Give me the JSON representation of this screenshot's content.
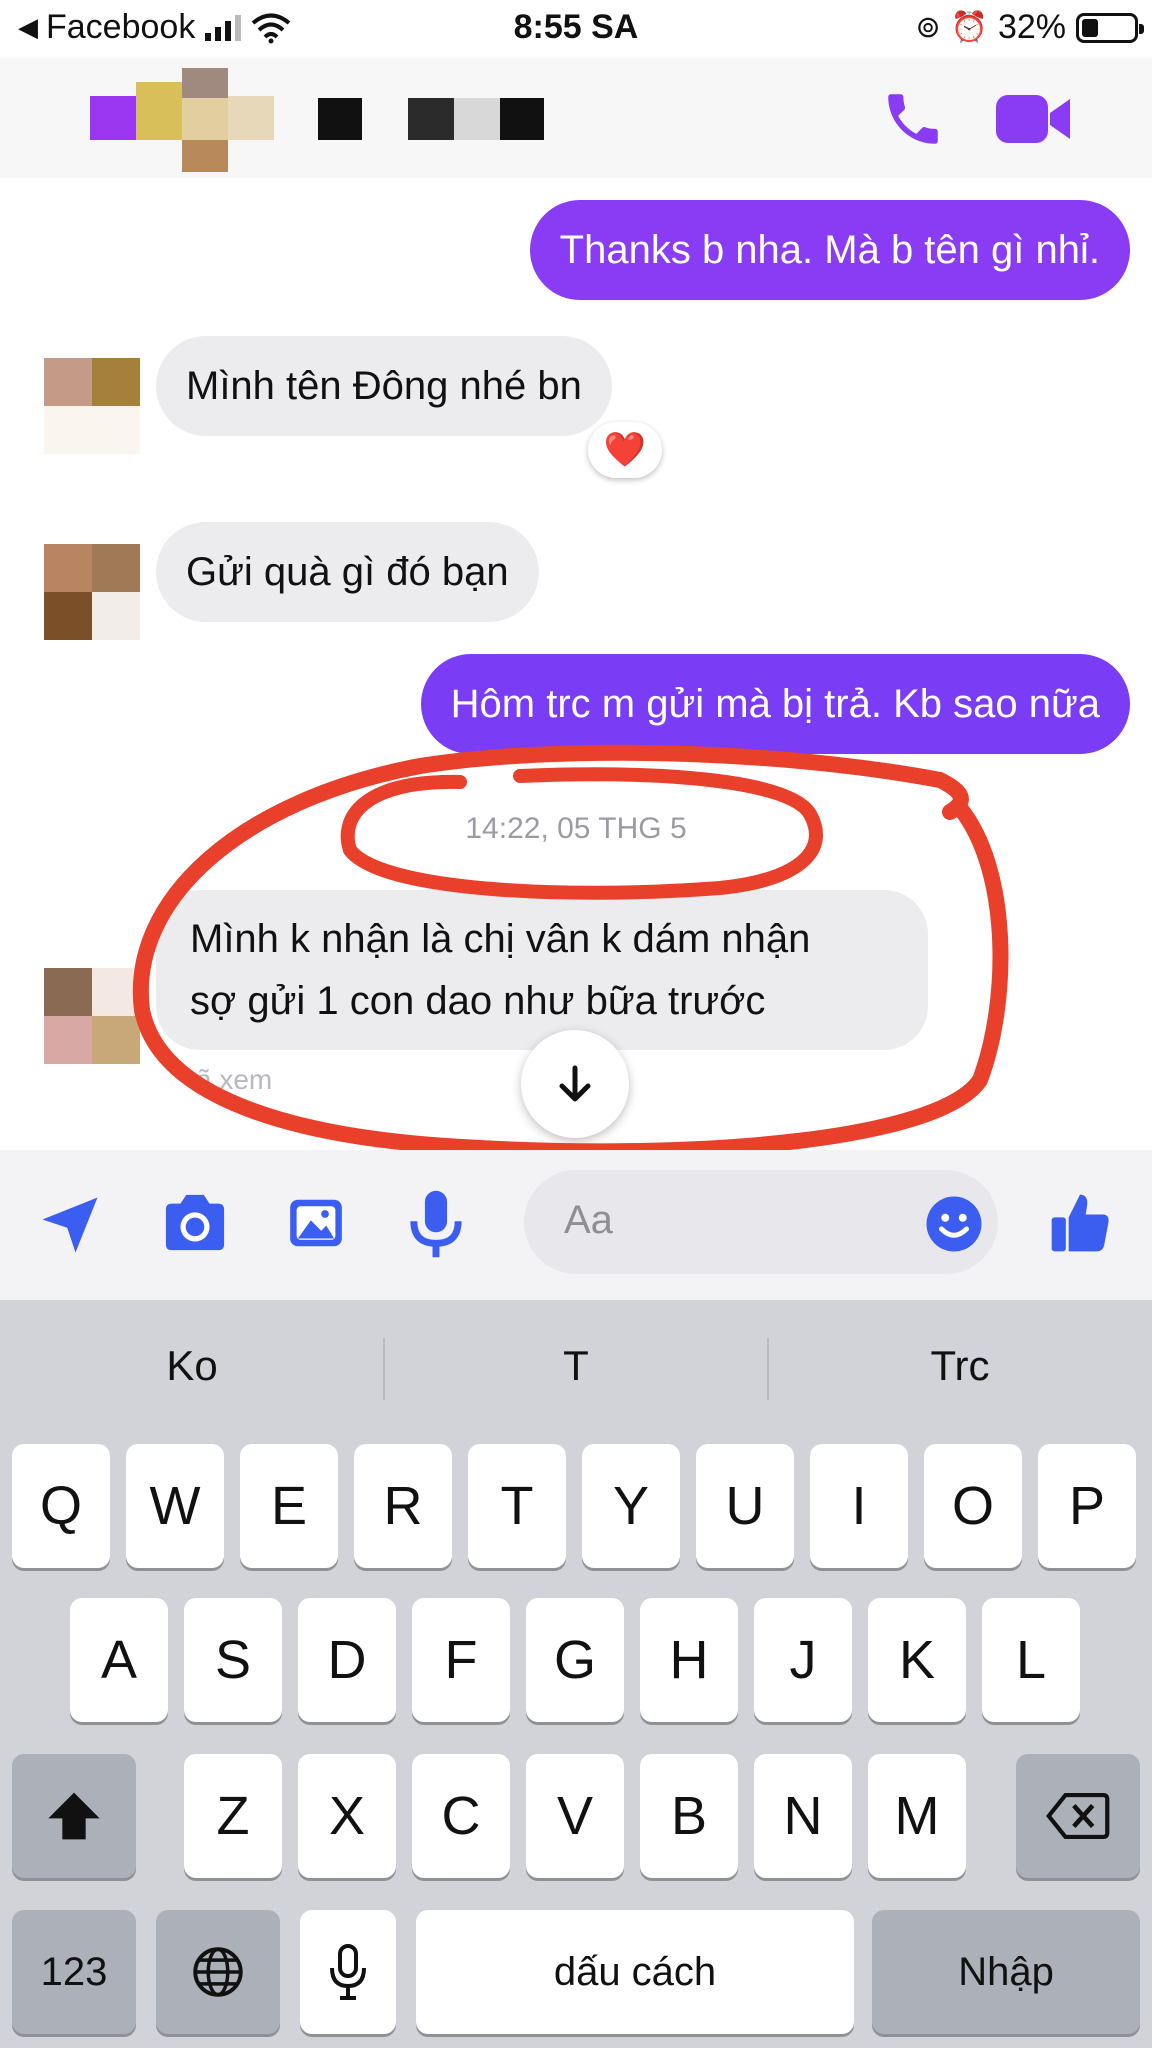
{
  "status_bar": {
    "back_app": "Facebook",
    "time": "8:55 SA",
    "battery": "32%",
    "battery_level": 0.32
  },
  "header": {
    "contact_name_redacted": true,
    "icons": [
      "phone-icon",
      "video-call-icon"
    ]
  },
  "colors": {
    "accent": "#8a3cf4",
    "incoming_bubble": "#ececef",
    "annotation": "#e8402b"
  },
  "messages": [
    {
      "dir": "out",
      "text": "Thanks b nha. Mà b tên gì nhỉ."
    },
    {
      "dir": "in",
      "text": "Mình tên Đông nhé bn",
      "reaction": "❤️"
    },
    {
      "dir": "in",
      "text": "Gửi quà gì đó bạn"
    },
    {
      "dir": "out",
      "text": "Hôm trc m gửi mà bị trả. Kb sao nữa"
    },
    {
      "dir": "timestamp",
      "text": "14:22, 05 THG 5"
    },
    {
      "dir": "in",
      "lines": [
        "Mình k nhận là chị vân k dám nhận",
        "sợ gửi 1 con dao như bữa trước"
      ]
    }
  ],
  "seen_text": "ã xem",
  "composer": {
    "placeholder": "Aa",
    "icons": [
      "send-location-icon",
      "camera-icon",
      "gallery-icon",
      "microphone-icon",
      "emoji-icon",
      "like-icon"
    ]
  },
  "keyboard": {
    "suggestions": [
      "Ko",
      "T",
      "Trc"
    ],
    "row1": [
      "Q",
      "W",
      "E",
      "R",
      "T",
      "Y",
      "U",
      "I",
      "O",
      "P"
    ],
    "row2": [
      "A",
      "S",
      "D",
      "F",
      "G",
      "H",
      "J",
      "K",
      "L"
    ],
    "row3": [
      "Z",
      "X",
      "C",
      "V",
      "B",
      "N",
      "M"
    ],
    "numbers_key": "123",
    "space_key": "dấu cách",
    "return_key": "Nhập"
  }
}
